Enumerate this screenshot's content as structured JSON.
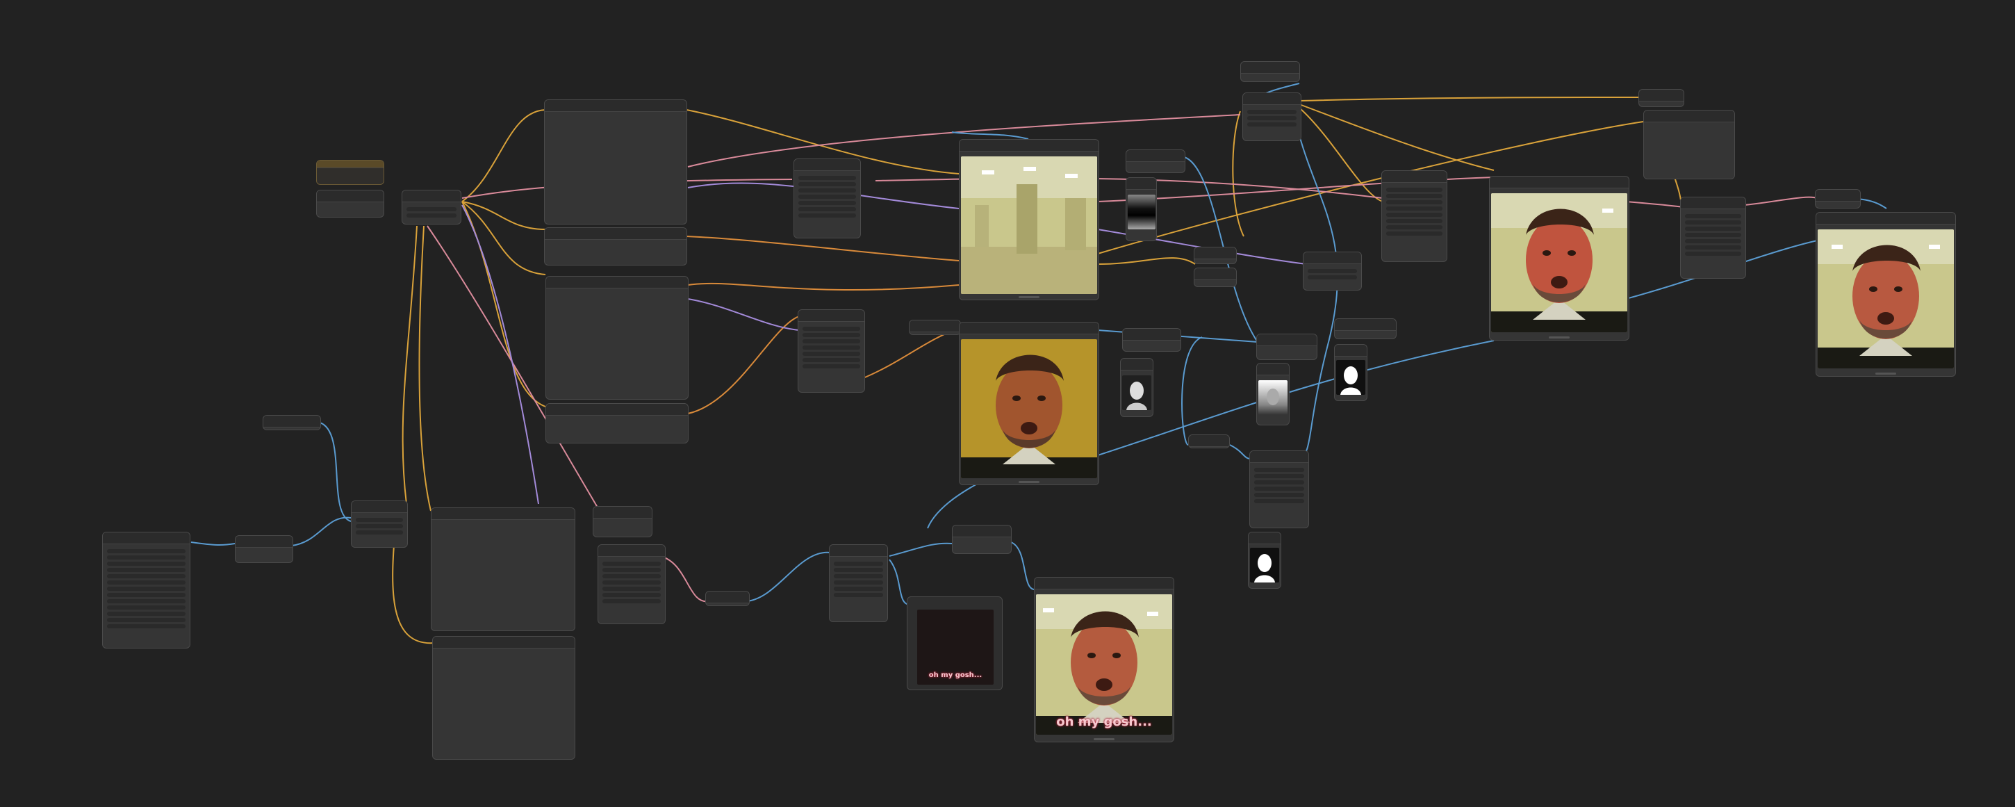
{
  "app": {
    "name": "node-graph-canvas"
  },
  "previews": {
    "caption_small": "oh my gosh...",
    "caption_large": "oh my gosh..."
  },
  "colors": {
    "background": "#222222",
    "node_body": "#353535",
    "link_yellow": "#d9a23a",
    "link_blue": "#5a9bd0",
    "link_pink": "#d98a9a",
    "link_purple": "#a38ad9",
    "link_orange": "#d98a3a"
  }
}
